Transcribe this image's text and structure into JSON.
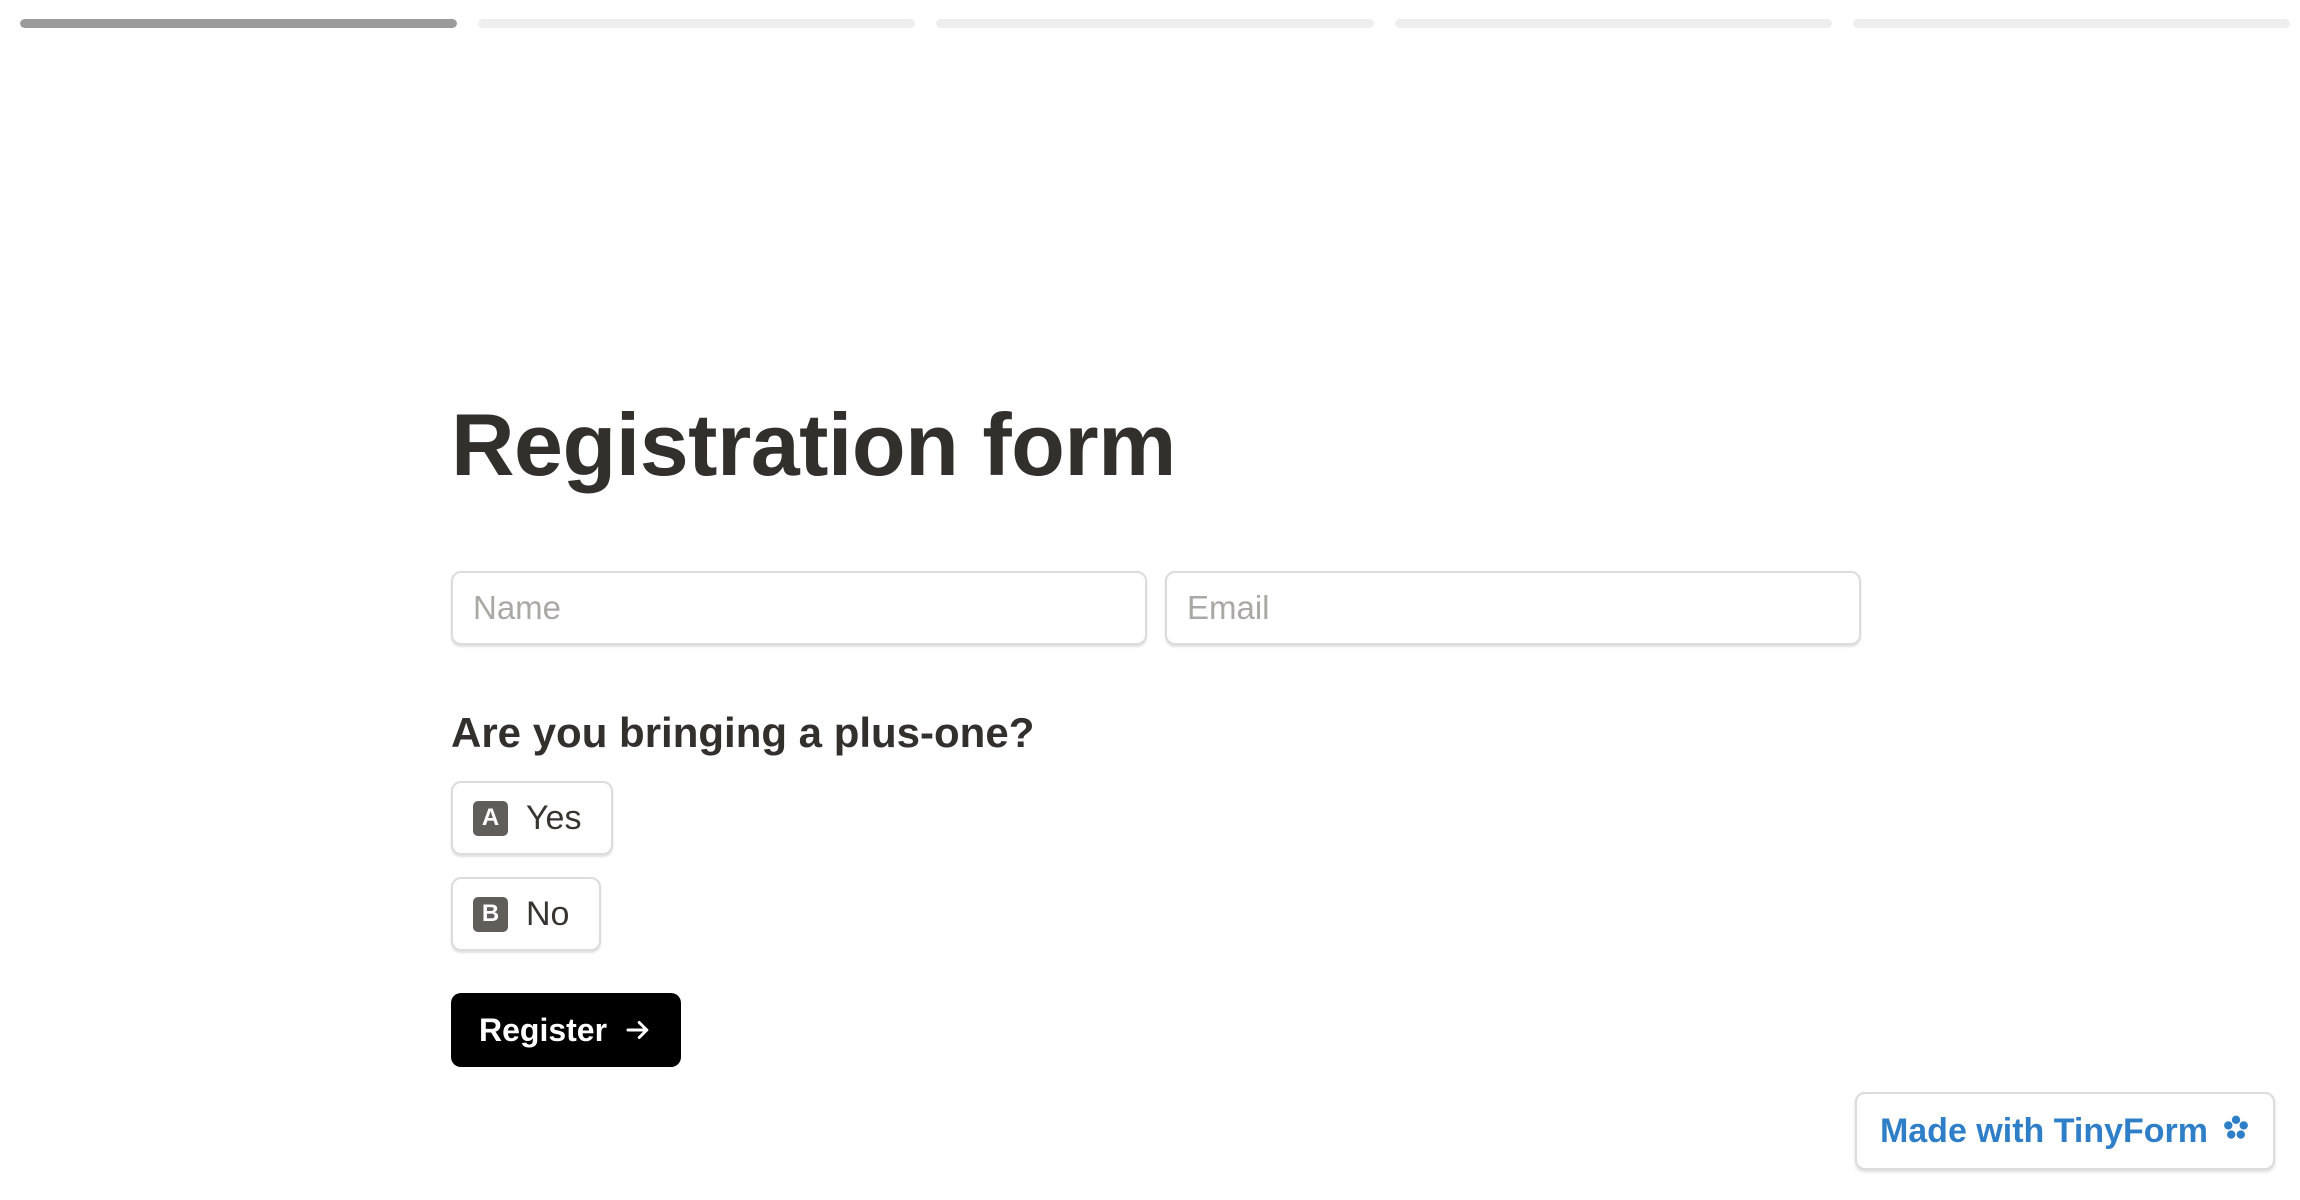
{
  "progress": {
    "segment_count": 5,
    "current_fraction": 1.0,
    "colors": {
      "filled": "#9b9b9b",
      "empty": "#eeeeee"
    }
  },
  "form": {
    "title": "Registration form",
    "fields": {
      "name_placeholder": "Name",
      "name_value": "",
      "email_placeholder": "Email",
      "email_value": ""
    },
    "question": "Are you bringing a plus-one?",
    "options": [
      {
        "key": "A",
        "label": "Yes"
      },
      {
        "key": "B",
        "label": "No"
      }
    ],
    "submit_label": "Register",
    "submit_icon": "arrow-right-icon"
  },
  "badge": {
    "text": "Made with TinyForm",
    "icon": "tinyform-flower-icon",
    "color": "#2f7fc8"
  }
}
